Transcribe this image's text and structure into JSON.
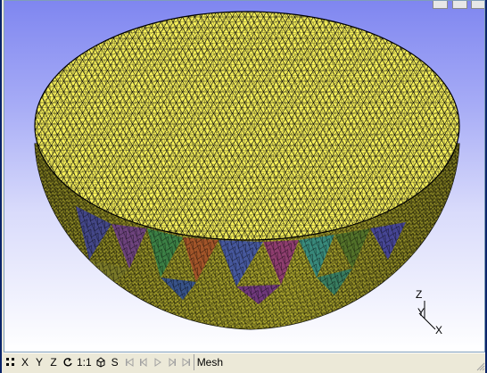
{
  "toolbar": {
    "fit_icon": "fit-all-icon",
    "x_label": "X",
    "y_label": "Y",
    "z_label": "Z",
    "rotate_icon": "rotate-icon",
    "scale_label": "1:1",
    "cube_icon": "cube-icon",
    "s_label": "S",
    "nav_icons": [
      "first-icon",
      "prev-icon",
      "play-icon",
      "next-icon",
      "last-icon"
    ]
  },
  "status": {
    "mode": "Mesh"
  },
  "axis_triad": {
    "z": "Z",
    "y": "Y",
    "x": "X"
  },
  "colors": {
    "mesh_fill": "#f7f15a",
    "mesh_lines": "#000000",
    "background_top": "#7f86f0",
    "background_bottom": "#ffffff",
    "statusbar": "#ece9d8"
  }
}
